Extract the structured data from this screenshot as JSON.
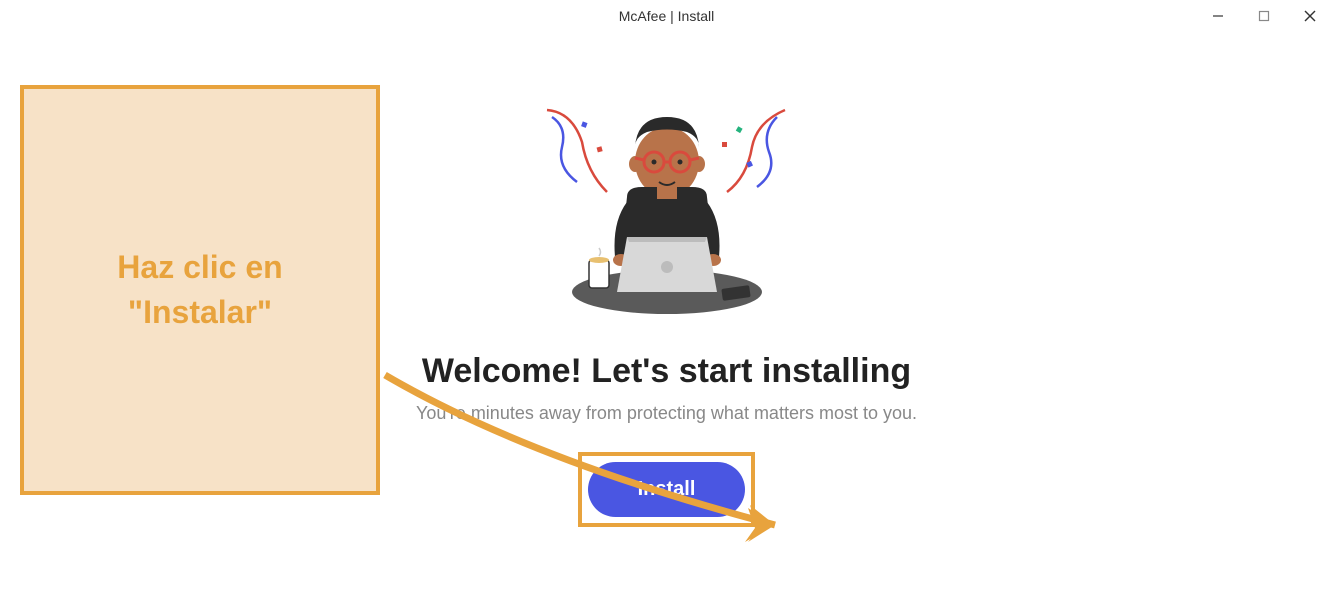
{
  "titlebar": {
    "title": "McAfee | Install"
  },
  "main": {
    "heading": "Welcome! Let's start installing",
    "subtext": "You're minutes away from protecting what matters most to you.",
    "install_label": "Install"
  },
  "callout": {
    "text": "Haz clic en \"Instalar\""
  },
  "colors": {
    "accent_orange": "#e8a33d",
    "callout_bg": "#f7e2c7",
    "button_blue": "#4a56e2"
  }
}
